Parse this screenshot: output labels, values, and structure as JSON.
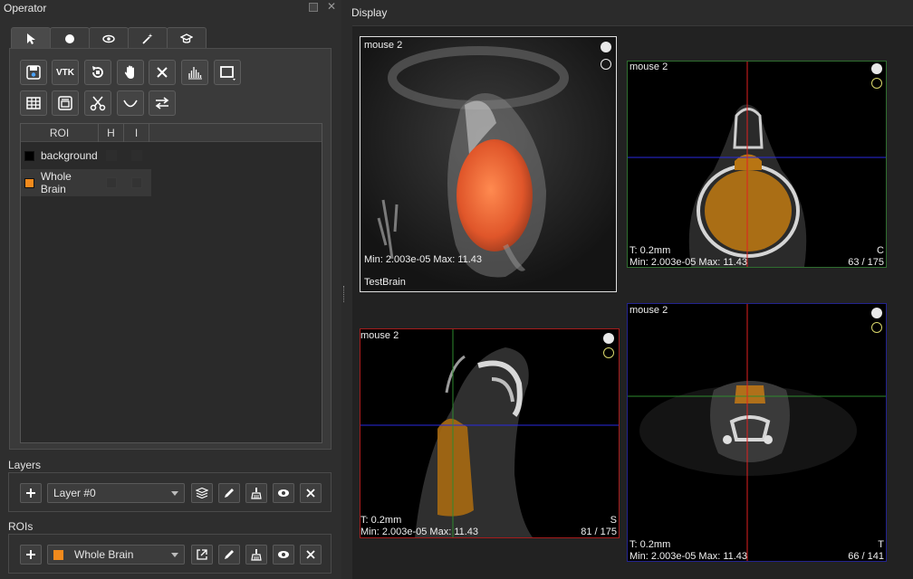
{
  "operator": {
    "title": "Operator",
    "tabs": [
      "pointer-icon",
      "circle-icon",
      "eye-icon",
      "magic-wand-icon",
      "graduation-cap-icon"
    ],
    "tool_labels": {
      "vtk": "VTK"
    },
    "roi_table": {
      "headers": [
        "ROI",
        "H",
        "I"
      ],
      "rows": [
        {
          "name": "background",
          "color": "#000000"
        },
        {
          "name": "Whole Brain",
          "color": "#f28a1c"
        }
      ]
    }
  },
  "layers": {
    "label": "Layers",
    "selected": "Layer #0"
  },
  "rois": {
    "label": "ROIs",
    "selected": "Whole Brain",
    "selected_color": "#f28a1c"
  },
  "display": {
    "title": "Display",
    "views": {
      "three_d": {
        "name": "mouse 2",
        "minmax": "Min: 2.003e-05 Max: 11.43",
        "dataset": "TestBrain"
      },
      "coronal": {
        "name": "mouse 2",
        "thickness": "T: 0.2mm",
        "minmax": "Min: 2.003e-05 Max: 11.43",
        "orientation": "C",
        "slice": "63 / 175"
      },
      "sagittal": {
        "name": "mouse 2",
        "thickness": "T: 0.2mm",
        "minmax": "Min: 2.003e-05 Max: 11.43",
        "orientation": "S",
        "slice": "81 / 175"
      },
      "transverse": {
        "name": "mouse 2",
        "thickness": "T: 0.2mm",
        "minmax": "Min: 2.003e-05 Max: 11.43",
        "orientation": "T",
        "slice": "66 / 141"
      }
    }
  }
}
